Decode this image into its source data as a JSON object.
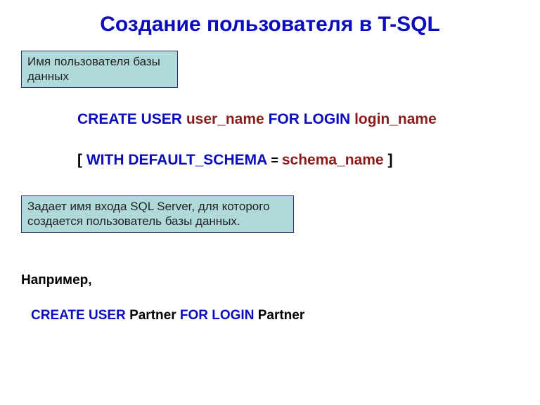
{
  "title": "Создание пользователя в T-SQL",
  "callouts": {
    "user_name_desc": "Имя пользователя базы данных",
    "login_name_desc": "Задает имя входа SQL Server, для которого создается пользователь базы данных."
  },
  "syntax": {
    "create_user": "CREATE USER",
    "user_name": "user_name",
    "for_login": "FOR LOGIN",
    "login_name": "login_name",
    "bracket_open": "[",
    "with_default_schema": "WITH DEFAULT_SCHEMA",
    "equals": " = ",
    "schema_name": "schema_name",
    "bracket_close": "]"
  },
  "example_label": "Например,",
  "example": {
    "create_user": "CREATE USER",
    "user": "Partner",
    "for_login": "FOR LOGIN",
    "login": "Partner"
  }
}
